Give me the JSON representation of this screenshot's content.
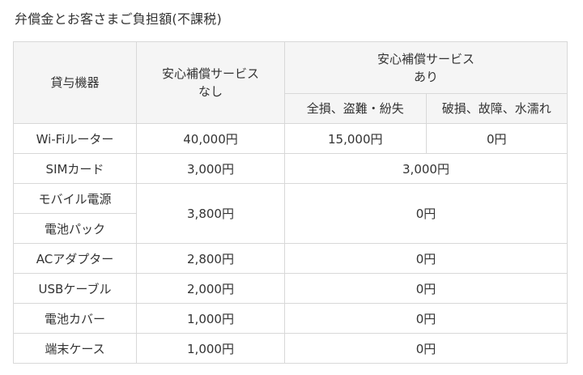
{
  "title": "弁償金とお客さまご負担額(不課税)",
  "headers": {
    "device": "貸与機器",
    "no_service_line1": "安心補償サービス",
    "no_service_line2": "なし",
    "with_service_line1": "安心補償サービス",
    "with_service_line2": "あり",
    "loss_theft": "全損、盗難・紛失",
    "damage_water": "破損、故障、水濡れ"
  },
  "rows": [
    {
      "device": "Wi-Fiルーター",
      "no_service": "40,000円",
      "loss_theft": "15,000円",
      "damage_water": "0円"
    },
    {
      "device": "SIMカード",
      "no_service": "3,000円",
      "with_service": "3,000円"
    },
    {
      "device_line1": "モバイル電源",
      "device_line2": "電池パック",
      "no_service": "3,800円",
      "with_service": "0円"
    },
    {
      "device": "ACアダプター",
      "no_service": "2,800円",
      "with_service": "0円"
    },
    {
      "device": "USBケーブル",
      "no_service": "2,000円",
      "with_service": "0円"
    },
    {
      "device": "電池カバー",
      "no_service": "1,000円",
      "with_service": "0円"
    },
    {
      "device": "端末ケース",
      "no_service": "1,000円",
      "with_service": "0円"
    }
  ]
}
